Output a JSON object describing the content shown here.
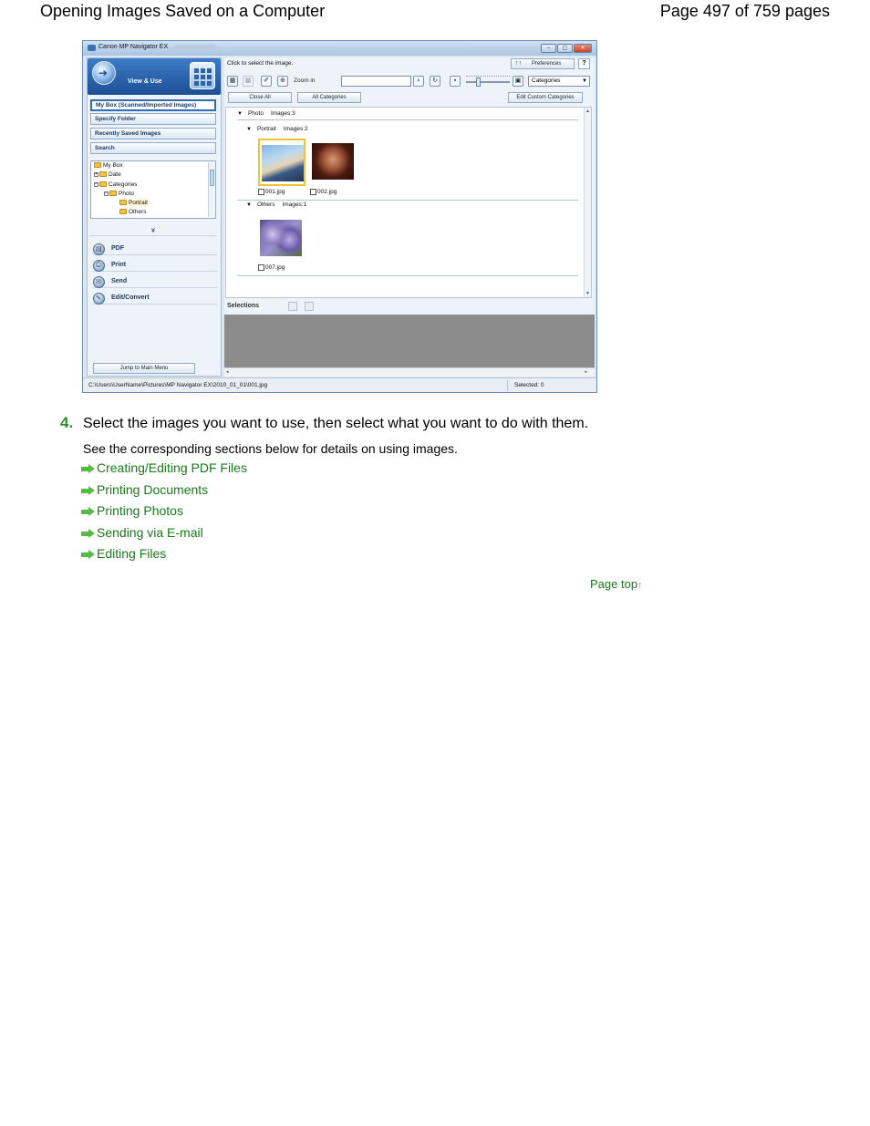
{
  "header": {
    "title": "Opening Images Saved on a Computer",
    "page_number": "Page 497 of 759 pages"
  },
  "app": {
    "window_title": "Canon MP Navigator EX",
    "window_buttons": [
      "–",
      "▢",
      "✕"
    ],
    "mode_label": "View & Use",
    "nav": {
      "my_box": "My Box (Scanned/Imported Images)",
      "specify_folder": "Specify Folder",
      "recently_saved": "Recently Saved Images",
      "search": "Search"
    },
    "tree": {
      "my_box": "My Box",
      "date": "Date",
      "categories": "Categories",
      "photo": "Photo",
      "portrait": "Portrait",
      "others": "Others"
    },
    "expander": "¥",
    "actions": {
      "pdf": "PDF",
      "print": "Print",
      "send": "Send",
      "edit_convert": "Edit/Convert"
    },
    "jump_button": "Jump to Main Menu",
    "instruction": "Click to select the image.",
    "preferences": "Preferences",
    "help": "?",
    "zoom_in": "Zoom in",
    "category_select": "Categories",
    "buttons": {
      "close_all": "Close All",
      "all_categories": "All Categories",
      "edit_custom": "Edit Custom Categories"
    },
    "groups": {
      "photo": {
        "name": "Photo",
        "count": "Images:3"
      },
      "portrait": {
        "name": "Portrait",
        "count": "Images:2"
      },
      "others": {
        "name": "Others",
        "count": "Images:1"
      }
    },
    "files": [
      "001.jpg",
      "002.jpg",
      "007.jpg"
    ],
    "selections_label": "Selections",
    "status_path": "C:\\Users\\UserName\\Pictures\\MP Navigator EX\\2010_01_01\\001.jpg",
    "status_selected": "Selected: 0"
  },
  "step": {
    "number": "4.",
    "text": "Select the images you want to use, then select what you want to do with them.",
    "description": "See the corresponding sections below for details on using images."
  },
  "links": [
    "Creating/Editing PDF Files",
    "Printing Documents",
    "Printing Photos",
    "Sending via E-mail",
    "Editing Files"
  ],
  "page_top": "Page top"
}
